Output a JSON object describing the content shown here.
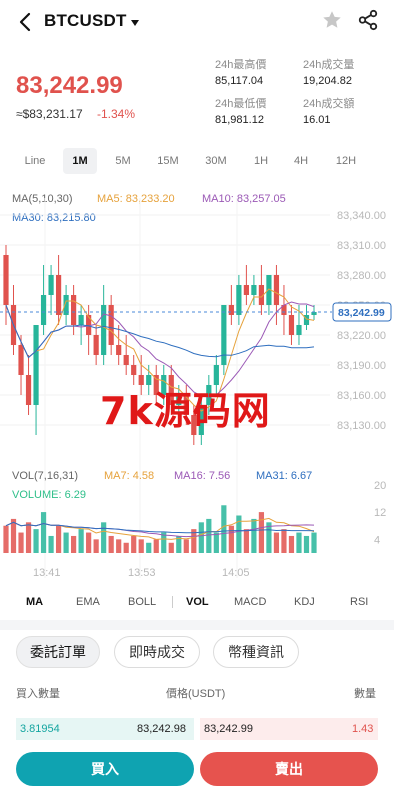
{
  "header": {
    "pair": "BTCUSDT",
    "back_icon": "chevron-left-icon",
    "dropdown_icon": "caret-down-icon",
    "favorite_icon": "star-icon",
    "share_icon": "share-icon"
  },
  "price": {
    "last": "83,242.99",
    "fiat": "≈$83,231.17",
    "change": "-1.34%",
    "color_down": "#e0524d",
    "color_up": "#27b59a"
  },
  "stats": {
    "high_label": "24h最高價",
    "high_value": "85,117.04",
    "vol_label": "24h成交量",
    "vol_value": "19,204.82",
    "low_label": "24h最低價",
    "low_value": "81,981.12",
    "amount_label": "24h成交額",
    "amount_value": "16.01"
  },
  "intervals": [
    "Line",
    "1M",
    "5M",
    "15M",
    "30M",
    "1H",
    "4H",
    "12H"
  ],
  "active_interval": "1M",
  "ma": {
    "title": "MA(5,10,30)",
    "ma5": "MA5: 83,233.20",
    "ma10": "MA10: 83,257.05",
    "ma30": "MA30: 83,215.80",
    "colors": {
      "ma5": "#e6a23c",
      "ma10": "#9b59b6",
      "ma30": "#2f6fbf"
    }
  },
  "price_axis": [
    "83,340.00",
    "83,310.00",
    "83,280.00",
    "83,250.00",
    "83,220.00",
    "83,190.00",
    "83,160.00",
    "83,130.00"
  ],
  "current_price_tag": "83,242.99",
  "watermark": "7k源码网",
  "vol": {
    "title": "VOL(7,16,31)",
    "ma7": "MA7: 4.58",
    "ma16": "MA16: 7.56",
    "ma31": "MA31: 6.67",
    "volume": "VOLUME: 6.29",
    "axis": [
      "20",
      "12",
      "4"
    ]
  },
  "time_axis": [
    "13:41",
    "13:53",
    "14:05"
  ],
  "indicator_tabs": [
    "MA",
    "EMA",
    "BOLL",
    "VOL",
    "MACD",
    "KDJ",
    "RSI"
  ],
  "order_tabs": [
    "委託訂單",
    "即時成交",
    "幣種資訊"
  ],
  "book": {
    "col_qty": "買入數量",
    "col_price": "價格(USDT)",
    "col_qty2": "數量",
    "bid_qty": "3.81954",
    "bid_price": "83,242.98",
    "ask_price": "83,242.99",
    "ask_qty": "1.43"
  },
  "actions": {
    "buy": "買入",
    "sell": "賣出"
  },
  "candles": [
    [
      83300,
      83310,
      83250,
      83230
    ],
    [
      83250,
      83270,
      83210,
      83200
    ],
    [
      83210,
      83220,
      83180,
      83160
    ],
    [
      83180,
      83200,
      83150,
      83140
    ],
    [
      83150,
      83180,
      83230,
      83120
    ],
    [
      83230,
      83290,
      83260,
      83220
    ],
    [
      83260,
      83290,
      83280,
      83240
    ],
    [
      83280,
      83300,
      83240,
      83230
    ],
    [
      83240,
      83270,
      83260,
      83230
    ],
    [
      83260,
      83270,
      83230,
      83220
    ],
    [
      83230,
      83250,
      83240,
      83210
    ],
    [
      83240,
      83250,
      83220,
      83200
    ],
    [
      83220,
      83230,
      83200,
      83190
    ],
    [
      83200,
      83270,
      83250,
      83190
    ],
    [
      83250,
      83260,
      83210,
      83200
    ],
    [
      83210,
      83230,
      83200,
      83190
    ],
    [
      83200,
      83220,
      83190,
      83180
    ],
    [
      83190,
      83200,
      83180,
      83170
    ],
    [
      83180,
      83200,
      83170,
      83160
    ],
    [
      83170,
      83190,
      83180,
      83160
    ],
    [
      83180,
      83190,
      83160,
      83150
    ],
    [
      83160,
      83190,
      83180,
      83150
    ],
    [
      83180,
      83190,
      83150,
      83140
    ],
    [
      83150,
      83170,
      83160,
      83140
    ],
    [
      83160,
      83170,
      83140,
      83130
    ],
    [
      83140,
      83150,
      83120,
      83110
    ],
    [
      83120,
      83160,
      83150,
      83110
    ],
    [
      83150,
      83180,
      83170,
      83140
    ],
    [
      83170,
      83200,
      83190,
      83160
    ],
    [
      83190,
      83220,
      83250,
      83180
    ],
    [
      83250,
      83270,
      83240,
      83230
    ],
    [
      83240,
      83280,
      83270,
      83230
    ],
    [
      83270,
      83290,
      83260,
      83250
    ],
    [
      83260,
      83280,
      83270,
      83250
    ],
    [
      83270,
      83290,
      83250,
      83240
    ],
    [
      83250,
      83260,
      83280,
      83240
    ],
    [
      83280,
      83290,
      83250,
      83230
    ],
    [
      83250,
      83270,
      83240,
      83220
    ],
    [
      83240,
      83250,
      83220,
      83210
    ],
    [
      83220,
      83250,
      83230,
      83210
    ],
    [
      83230,
      83250,
      83240,
      83225
    ],
    [
      83240,
      83250,
      83243,
      83235
    ]
  ],
  "volumes": [
    8,
    10,
    6,
    9,
    7,
    12,
    5,
    8,
    6,
    5,
    7,
    6,
    4,
    9,
    5,
    4,
    3,
    5,
    4,
    3,
    4,
    6,
    3,
    5,
    4,
    7,
    9,
    10,
    6,
    14,
    8,
    11,
    7,
    10,
    12,
    9,
    6,
    7,
    5,
    6,
    5,
    6
  ]
}
